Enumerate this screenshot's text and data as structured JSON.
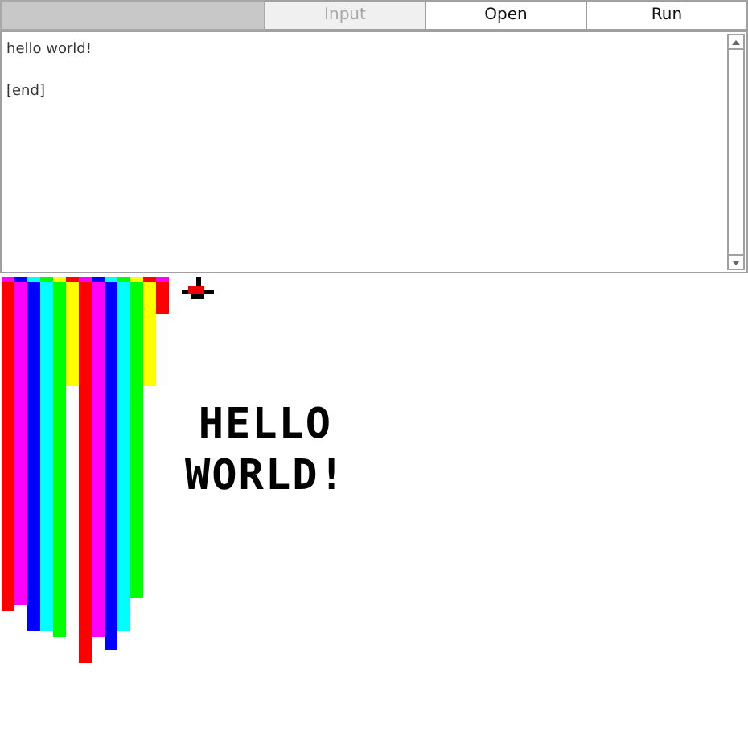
{
  "toolbar": {
    "buttons": [
      {
        "label": "Input",
        "disabled": true
      },
      {
        "label": "Open",
        "disabled": false
      },
      {
        "label": "Run",
        "disabled": false
      }
    ]
  },
  "console": {
    "lines": [
      "hello world!",
      "[end]"
    ]
  },
  "canvas": {
    "text_lines": [
      "HELLO",
      "WORLD!"
    ]
  }
}
